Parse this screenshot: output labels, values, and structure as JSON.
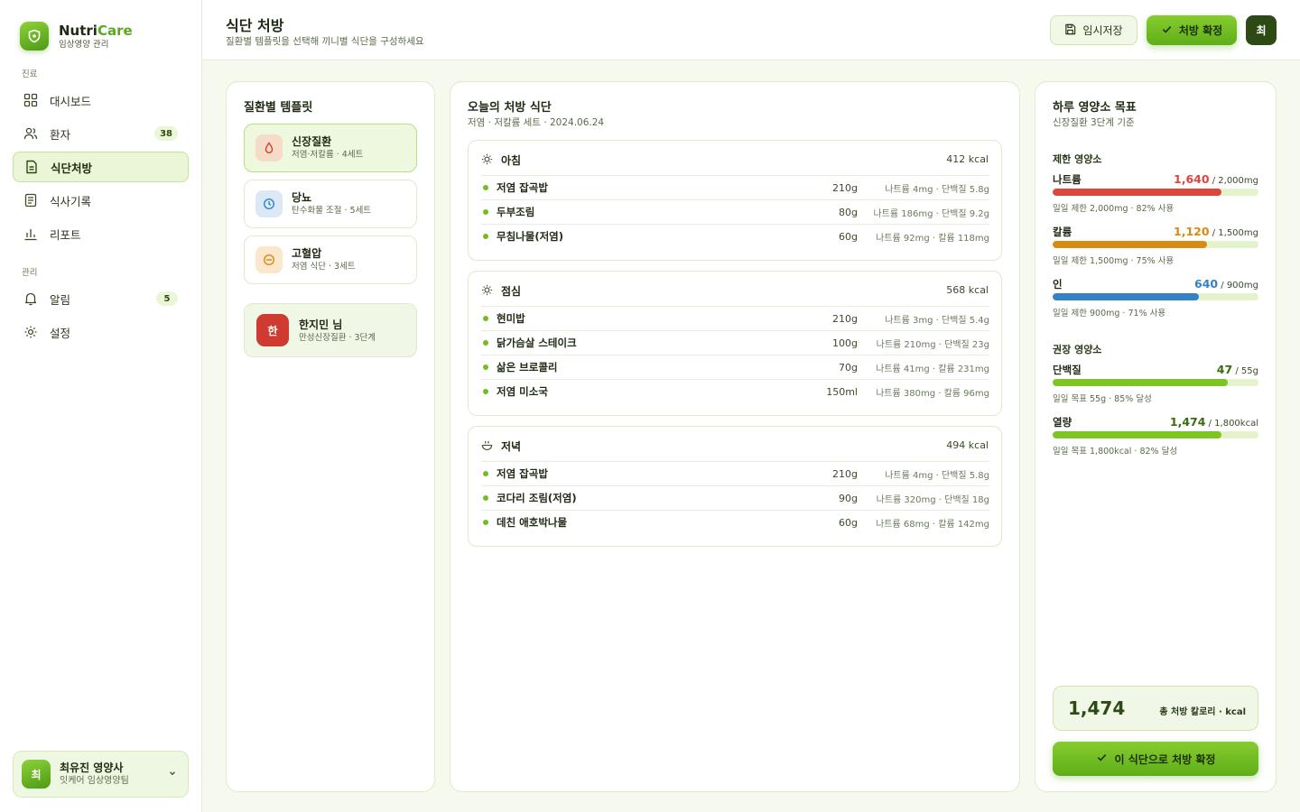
{
  "brand": {
    "name_a": "Nutri",
    "name_b": "Care",
    "sub": "임상영양 관리"
  },
  "sidebar": {
    "section_clinic": "진료",
    "section_manage": "관리",
    "items": [
      {
        "label": "대시보드",
        "icon": "grid-icon"
      },
      {
        "label": "환자",
        "icon": "users-icon",
        "badge": "38"
      },
      {
        "label": "식단처방",
        "icon": "prescription-doc-icon",
        "active": true
      },
      {
        "label": "식사기록",
        "icon": "notes-icon"
      },
      {
        "label": "리포트",
        "icon": "bar-chart-icon"
      },
      {
        "label": "알림",
        "icon": "bell-icon",
        "badge": "5"
      },
      {
        "label": "설정",
        "icon": "gear-icon"
      }
    ],
    "user": {
      "initial": "최",
      "name": "최유진 영양사",
      "team": "잇케어 임상영양팀"
    }
  },
  "header": {
    "title": "식단 처방",
    "subtitle": "질환별 템플릿을 선택해 끼니별 식단을 구성하세요",
    "draft_label": "임시저장",
    "confirm_label": "처방 확정",
    "avatar": "최"
  },
  "templates": {
    "title": "질환별 템플릿",
    "items": [
      {
        "name": "신장질환",
        "desc": "저염·저칼륨 · 4세트",
        "icon": "drop-icon",
        "active": true
      },
      {
        "name": "당뇨",
        "desc": "탄수화물 조절 · 5세트",
        "icon": "clock-icon"
      },
      {
        "name": "고혈압",
        "desc": "저염 식단 · 3세트",
        "icon": "minus-circle-icon"
      }
    ],
    "patient": {
      "initial": "한",
      "name": "한지민 님",
      "desc": "만성신장질환 · 3단계"
    }
  },
  "meals": {
    "title": "오늘의 처방 식단",
    "subtitle": "저염 · 저칼륨 세트 · 2024.06.24",
    "list": [
      {
        "name": "아침",
        "kcal": "412 kcal",
        "icon": "sun-icon",
        "foods": [
          {
            "name": "저염 잡곡밥",
            "qty": "210g",
            "nut": "나트륨 4mg · 단백질 5.8g"
          },
          {
            "name": "두부조림",
            "qty": "80g",
            "nut": "나트륨 186mg · 단백질 9.2g"
          },
          {
            "name": "무침나물(저염)",
            "qty": "60g",
            "nut": "나트륨 92mg · 칼륨 118mg"
          }
        ]
      },
      {
        "name": "점심",
        "kcal": "568 kcal",
        "icon": "sun-icon",
        "foods": [
          {
            "name": "현미밥",
            "qty": "210g",
            "nut": "나트륨 3mg · 단백질 5.4g"
          },
          {
            "name": "닭가슴살 스테이크",
            "qty": "100g",
            "nut": "나트륨 210mg · 단백질 23g"
          },
          {
            "name": "삶은 브로콜리",
            "qty": "70g",
            "nut": "나트륨 41mg · 칼륨 231mg"
          },
          {
            "name": "저염 미소국",
            "qty": "150ml",
            "nut": "나트륨 380mg · 칼륨 96mg"
          }
        ]
      },
      {
        "name": "저녁",
        "kcal": "494 kcal",
        "icon": "bowl-icon",
        "foods": [
          {
            "name": "저염 잡곡밥",
            "qty": "210g",
            "nut": "나트륨 4mg · 단백질 5.8g"
          },
          {
            "name": "코다리 조림(저염)",
            "qty": "90g",
            "nut": "나트륨 320mg · 단백질 18g"
          },
          {
            "name": "데친 애호박나물",
            "qty": "60g",
            "nut": "나트륨 68mg · 칼륨 142mg"
          }
        ]
      }
    ]
  },
  "nutrients": {
    "title": "하루 영양소 목표",
    "subtitle": "신장질환 3단계 기준",
    "limit_label": "제한 영양소",
    "recommend_label": "권장 영양소",
    "limit": [
      {
        "name": "나트륨",
        "value": "1,640",
        "target": " / 2,000mg",
        "note": "일일 제한 2,000mg · 82% 사용",
        "fraction": 0.82,
        "color": "#e0453b"
      },
      {
        "name": "칼륨",
        "value": "1,120",
        "target": " / 1,500mg",
        "note": "일일 제한 1,500mg · 75% 사용",
        "fraction": 0.75,
        "color": "#d98a12"
      },
      {
        "name": "인",
        "value": "640",
        "target": " / 900mg",
        "note": "일일 제한 900mg · 71% 사용",
        "fraction": 0.71,
        "color": "#3282c8"
      }
    ],
    "recommend": [
      {
        "name": "단백질",
        "value": "47",
        "target": " / 55g",
        "note": "일일 목표 55g · 85% 달성",
        "fraction": 0.85,
        "color": "#7cc522"
      },
      {
        "name": "열량",
        "value": "1,474",
        "target": " / 1,800kcal",
        "note": "일일 목표 1,800kcal · 82% 달성",
        "fraction": 0.82,
        "color": "#7cc522"
      }
    ],
    "total_value": "1,474",
    "total_label": "총 처방 칼로리 · kcal",
    "final_button": "이 식단으로 처방 확정"
  },
  "colors": {
    "accent": "#6cb823",
    "accent_dark": "#2e4a14",
    "danger": "#e0453b"
  }
}
